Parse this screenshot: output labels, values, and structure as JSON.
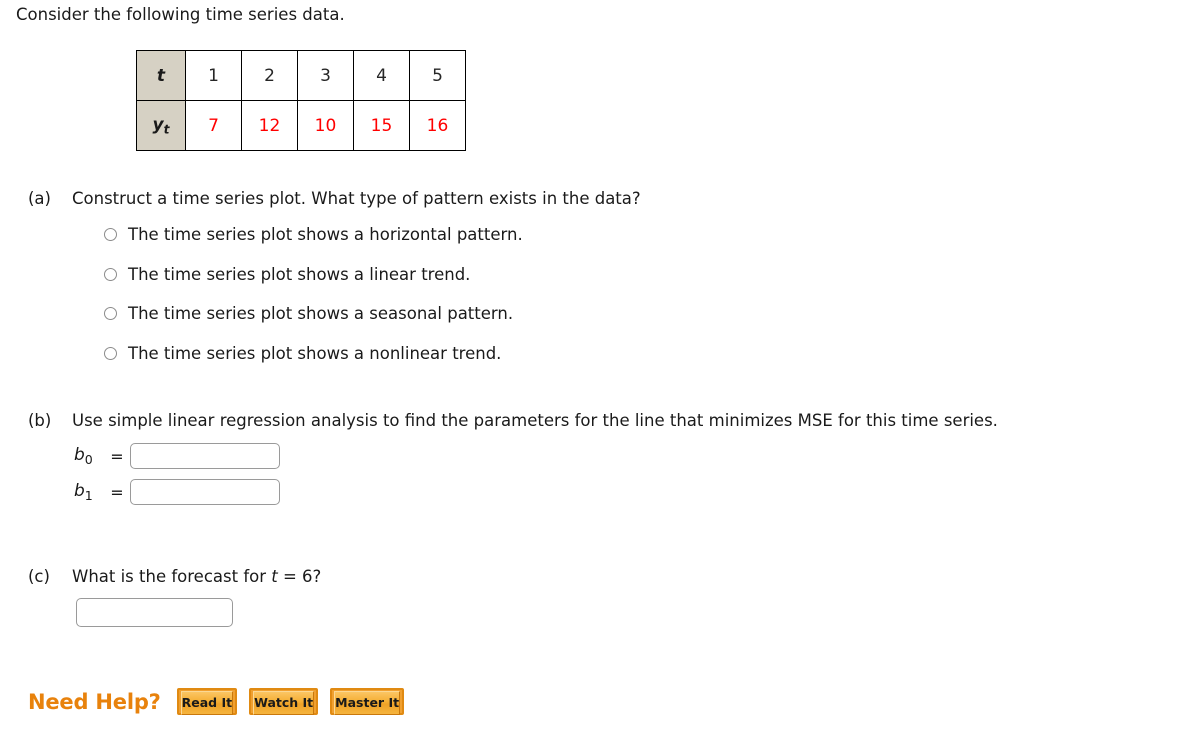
{
  "intro": {
    "text": "Consider the following time series data."
  },
  "data_table": {
    "row_headers": [
      "t",
      "y"
    ],
    "row_header_subscripts": [
      "",
      "t"
    ],
    "t_values": [
      "1",
      "2",
      "3",
      "4",
      "5"
    ],
    "y_values": [
      "7",
      "12",
      "10",
      "15",
      "16"
    ],
    "header_bg": "#d6d1c4",
    "y_value_color": "#ff0000"
  },
  "part_a": {
    "label": "(a)",
    "question": "Construct a time series plot. What type of pattern exists in the data?",
    "options": [
      {
        "label": "The time series plot shows a horizontal pattern.",
        "selected": false
      },
      {
        "label": "The time series plot shows a linear trend.",
        "selected": false
      },
      {
        "label": "The time series plot shows a seasonal pattern.",
        "selected": false
      },
      {
        "label": "The time series plot shows a nonlinear trend.",
        "selected": false
      }
    ]
  },
  "part_b": {
    "label": "(b)",
    "question": "Use simple linear regression analysis to find the parameters for the line that minimizes MSE for this time series.",
    "fields": [
      {
        "name": "b",
        "subscript": "0",
        "equals": "=",
        "value": "",
        "placeholder": ""
      },
      {
        "name": "b",
        "subscript": "1",
        "equals": "=",
        "value": "",
        "placeholder": ""
      }
    ]
  },
  "part_c": {
    "label": "(c)",
    "question_prefix": "What is the forecast for ",
    "question_var": "t",
    "question_suffix": " = 6?",
    "answer": {
      "value": "",
      "placeholder": ""
    }
  },
  "need_help": {
    "label": "Need Help?",
    "label_color": "#e8820c",
    "buttons": [
      {
        "label": "Read It"
      },
      {
        "label": "Watch It"
      },
      {
        "label": "Master It"
      }
    ]
  }
}
